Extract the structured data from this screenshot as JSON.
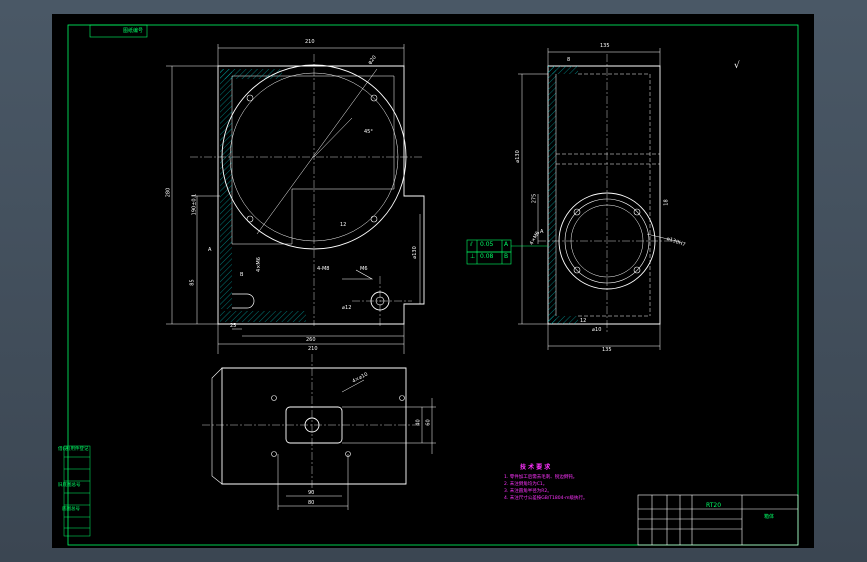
{
  "colors": {
    "background_outer": "#4a5866",
    "sheet": "#000000",
    "frame": "#00ff66",
    "outline": "#ffffff",
    "hatch": "#00c8c8",
    "datum": "#00ff66",
    "notes": "#ff33ff"
  },
  "title_block": {
    "drawing_code": "RT20",
    "name": "箱体"
  },
  "stamp": {
    "label": "图纸编号"
  },
  "left_strip": {
    "labels": [
      "借(通)用件登记",
      "",
      "旧底图总号",
      "",
      "底图总号",
      "",
      ""
    ]
  },
  "tolerance_frames": [
    {
      "symbol": "⫽",
      "value": "0.05",
      "datum": "A"
    },
    {
      "symbol": "⊥",
      "value": "0.08",
      "datum": "B"
    }
  ],
  "technical_requirements": {
    "title": "技 术 要 求",
    "items": [
      "1. 零件加工后需去毛刺、锐边倒钝。",
      "2. 未注倒角均为C1。",
      "3. 未注圆角半径为R2。",
      "4. 未注尺寸公差按GB/T1804-m级执行。"
    ]
  },
  "roughness_mark": "√",
  "front_view": {
    "width_top": "210",
    "width_bottom_inner": "260",
    "width_bottom": "210",
    "height_left": "280",
    "height_inner": "190±0.1",
    "height_lower": "85",
    "dim_small_left": "25",
    "bore": "⌀130",
    "bore_leader": "φ20",
    "hole_note": "4-M8",
    "thread_note": "M6",
    "tap_note": "4×M6",
    "small_bore": "⌀12",
    "angle_note": "45°",
    "dim_12": "12",
    "sym_a": "A",
    "sym_b": "B"
  },
  "side_view": {
    "width_top": "135",
    "width_bottom": "135",
    "dim_top_left": "8",
    "height_bore": "⌀130",
    "height_main": "275",
    "dim_side": "18",
    "bore_note": "⌀130H7",
    "hole_leader": "4×M6",
    "bottom_small": "12",
    "bottom_hole": "⌀10",
    "sym_a": "A"
  },
  "bottom_view": {
    "width_inner": "90",
    "width_outer": "80",
    "height_inner": "40",
    "height_outer": "60",
    "hole_note": "4×⌀10"
  }
}
